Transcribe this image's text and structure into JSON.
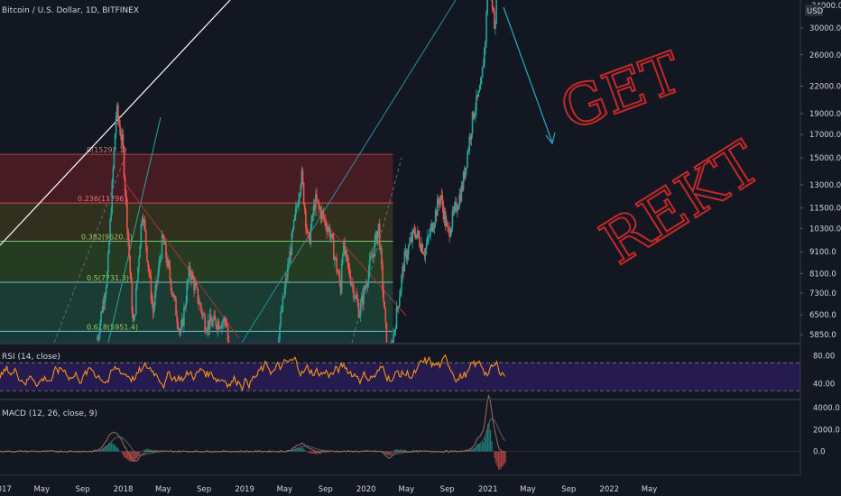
{
  "header": {
    "title": "Bitcoin / U.S. Dollar, 1D, BITFINEX",
    "currency_badge": "USD",
    "top_price_partial": "34000.0"
  },
  "annotation_text": [
    "GET",
    "REKT"
  ],
  "colors": {
    "background": "#131722",
    "candle_up": "#26a69a",
    "candle_down": "#ef5350",
    "rsi_line": "#f7931a",
    "rsi_band": "#2a1d5a",
    "annotation": "#c62828",
    "arrow": "#2a9db8",
    "trend_line": "#ffffff",
    "macd_line": "#8b6a5a",
    "signal_line": "#5d5f66"
  },
  "chart_data": [
    {
      "type": "candlestick",
      "name": "price",
      "title": "Bitcoin / U.S. Dollar, 1D, BITFINEX",
      "x_ticks": [
        "2017",
        "May",
        "Sep",
        "2018",
        "May",
        "Sep",
        "2019",
        "May",
        "Sep",
        "2020",
        "May",
        "Sep",
        "2021",
        "May",
        "Sep",
        "2022",
        "May"
      ],
      "y_scale": "log",
      "y_ticks": [
        5850,
        6500,
        7300,
        8100,
        9100,
        10300,
        11500,
        13000,
        15000,
        17000,
        19000,
        22000,
        26000,
        30000
      ],
      "y_tick_labels": [
        "5850.0",
        "6500.0",
        "7300.0",
        "8100.0",
        "9100.0",
        "10300.0",
        "11500.0",
        "13000.0",
        "15000.0",
        "17000.0",
        "19000.0",
        "22000.0",
        "26000.0",
        "30000.0"
      ],
      "ylim": [
        5600,
        34500
      ],
      "key_points": [
        {
          "x": "2017-12-17",
          "y": 19500
        },
        {
          "x": "2018-02-06",
          "y": 6000
        },
        {
          "x": "2019-06-26",
          "y": 13800
        },
        {
          "x": "2020-03-13",
          "y": 4000
        },
        {
          "x": "2020-12-31",
          "y": 29000
        },
        {
          "x": "2021-01-08",
          "y": 41900
        }
      ],
      "fibonacci": {
        "levels": [
          {
            "label": "0(15292.1)",
            "ratio": 0,
            "value": 15292.1
          },
          {
            "label": "0.236(11796)",
            "ratio": 0.236,
            "value": 11796
          },
          {
            "label": "0.382(9620.3)",
            "ratio": 0.382,
            "value": 9620.3
          },
          {
            "label": "0.5(7731.3)",
            "ratio": 0.5,
            "value": 7731.3
          },
          {
            "label": "0.618(5951.4)",
            "ratio": 0.618,
            "value": 5951.4
          }
        ],
        "zone_colors": [
          "#5a1e24",
          "#3b3a1f",
          "#2c4a23",
          "#1d4a3a",
          "#1b4347"
        ]
      }
    },
    {
      "type": "line",
      "name": "RSI (14, close)",
      "label": "RSI (14, close)",
      "y_ticks": [
        40,
        80
      ],
      "y_tick_labels": [
        "40.00",
        "80.00"
      ],
      "band": [
        30,
        70
      ],
      "ylim": [
        20,
        95
      ]
    },
    {
      "type": "line",
      "name": "MACD (12, 26, close, 9)",
      "label": "MACD (12, 26, close, 9)",
      "y_ticks": [
        0,
        2000,
        4000
      ],
      "y_tick_labels": [
        "0.0",
        "2000.0",
        "4000.0"
      ],
      "ylim": [
        -1200,
        4600
      ]
    }
  ]
}
